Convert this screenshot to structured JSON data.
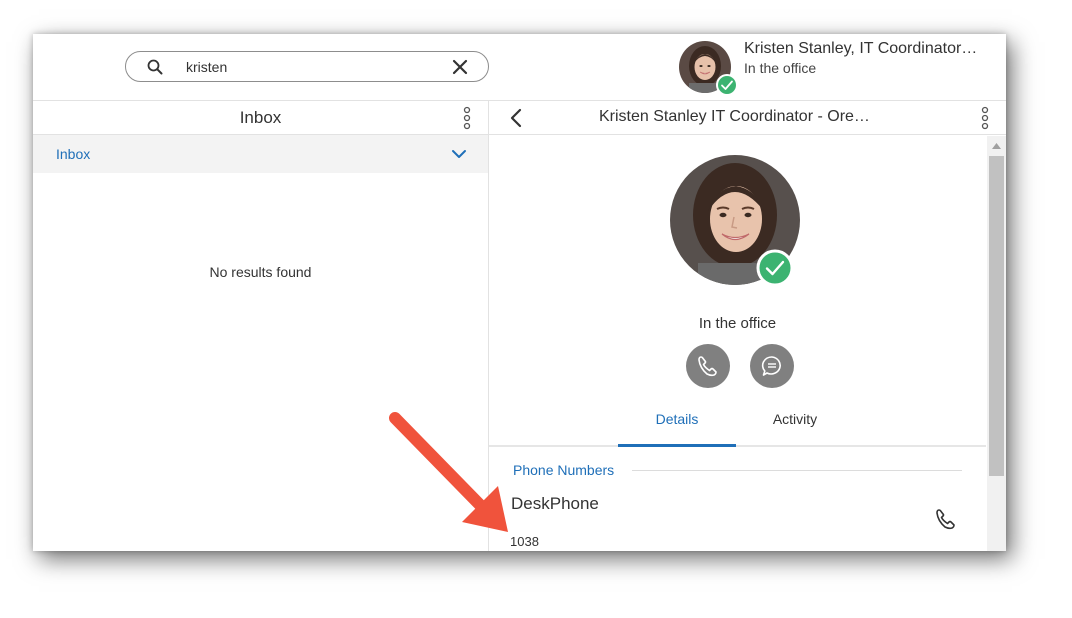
{
  "search": {
    "value": "kristen"
  },
  "user": {
    "name": "Kristen Stanley, IT Coordinator…",
    "status": "In the office"
  },
  "left_pane": {
    "title": "Inbox",
    "folder_label": "Inbox",
    "empty_message": "No results found"
  },
  "contact": {
    "title": "Kristen Stanley IT Coordinator - Ore…",
    "status": "In the office",
    "tabs": [
      {
        "label": "Details",
        "selected": true
      },
      {
        "label": "Activity",
        "selected": false
      }
    ],
    "phone_section": {
      "title": "Phone Numbers",
      "entries": [
        {
          "label": "DeskPhone",
          "number": "1038"
        }
      ]
    }
  },
  "icons": {
    "search": "search-icon",
    "clear": "close-icon",
    "menu": "kebab-menu-icon",
    "back": "chevron-left-icon",
    "expand": "chevron-down-icon",
    "presence": "checkmark-icon",
    "call": "phone-icon",
    "chat": "chat-bubble-icon"
  },
  "colors": {
    "accent": "#1f6fb8",
    "presence": "#3cb371",
    "action_button": "#808080",
    "annotation_arrow": "#f0533c"
  }
}
